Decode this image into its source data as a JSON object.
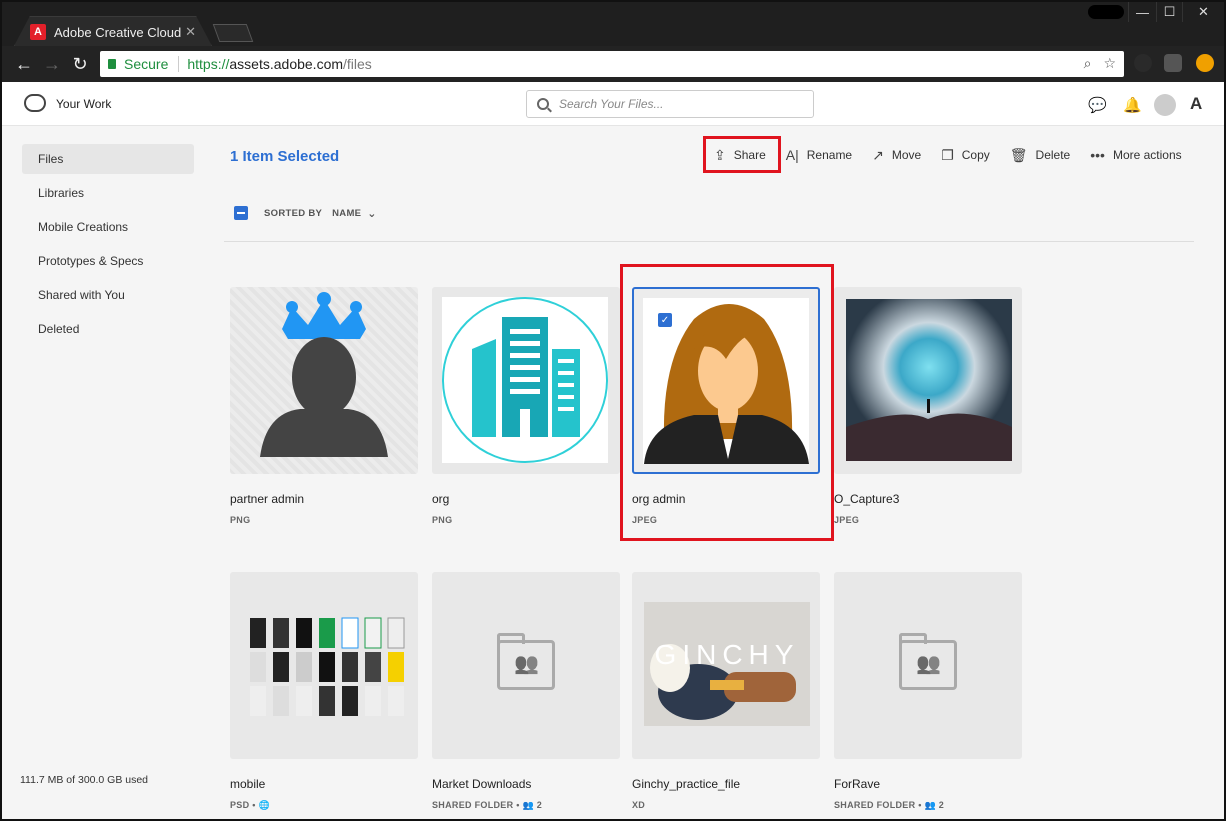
{
  "browser": {
    "tab_title": "Adobe Creative Cloud",
    "tab_close": "✕",
    "secure_label": "Secure",
    "url_protocol": "https://",
    "url_host": "assets.adobe.com",
    "url_path": "/files",
    "win_min": "—",
    "win_max": "☐",
    "win_close": "✕"
  },
  "header": {
    "app_name": "Your Work",
    "search_placeholder": "Search Your Files..."
  },
  "sidebar": {
    "items": [
      {
        "label": "Files",
        "active": true
      },
      {
        "label": "Libraries"
      },
      {
        "label": "Mobile Creations"
      },
      {
        "label": "Prototypes & Specs"
      },
      {
        "label": "Shared with You"
      },
      {
        "label": "Deleted"
      }
    ],
    "storage": "111.7 MB of 300.0 GB used"
  },
  "toolbar": {
    "selection": "1 Item Selected",
    "share": "Share",
    "rename": "Rename",
    "move": "Move",
    "copy": "Copy",
    "delete": "Delete",
    "more": "More actions"
  },
  "sort": {
    "label": "SORTED BY",
    "value": "NAME"
  },
  "files": [
    {
      "name": "partner admin",
      "type": "PNG"
    },
    {
      "name": "org",
      "type": "PNG"
    },
    {
      "name": "org admin",
      "type": "JPEG",
      "selected": true
    },
    {
      "name": "O_Capture3",
      "type": "JPEG"
    },
    {
      "name": "mobile",
      "type": "PSD •"
    },
    {
      "name": "Market Downloads",
      "type": "SHARED FOLDER •",
      "members": "2"
    },
    {
      "name": "Ginchy_practice_file",
      "type": "XD"
    },
    {
      "name": "ForRave",
      "type": "SHARED FOLDER •",
      "members": "2"
    }
  ],
  "ginchy_text": "GINCHY"
}
